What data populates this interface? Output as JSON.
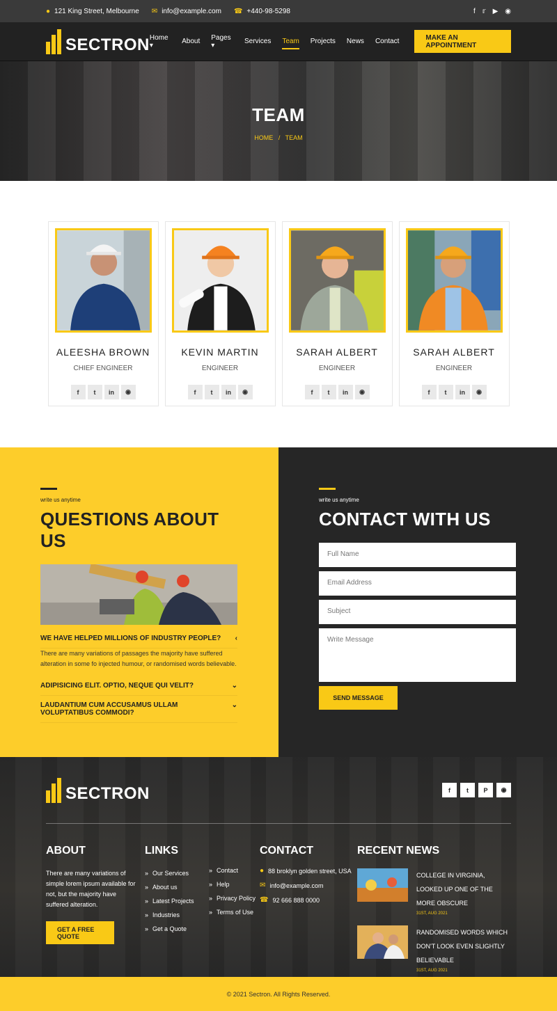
{
  "topbar": {
    "address": "121 King Street, Melbourne",
    "email": "info@example.com",
    "phone": "+440-98-5298",
    "social_icons": [
      "facebook-icon",
      "twitter-icon",
      "youtube-icon",
      "instagram-icon"
    ]
  },
  "brand": {
    "name": "SECTRON"
  },
  "nav": {
    "items": [
      {
        "label": "Home",
        "dropdown": true
      },
      {
        "label": "About",
        "dropdown": false
      },
      {
        "label": "Pages",
        "dropdown": true
      },
      {
        "label": "Services",
        "dropdown": false
      },
      {
        "label": "Team",
        "dropdown": false,
        "active": true
      },
      {
        "label": "Projects",
        "dropdown": false
      },
      {
        "label": "News",
        "dropdown": false
      },
      {
        "label": "Contact",
        "dropdown": false
      }
    ],
    "cta": "MAKE AN APPOINTMENT"
  },
  "hero": {
    "title": "TEAM",
    "crumb_home": "HOME",
    "crumb_sep": "/",
    "crumb_current": "TEAM"
  },
  "team": [
    {
      "name": "ALEESHA BROWN",
      "role": "CHIEF ENGINEER"
    },
    {
      "name": "KEVIN MARTIN",
      "role": "ENGINEER"
    },
    {
      "name": "SARAH ALBERT",
      "role": "ENGINEER"
    },
    {
      "name": "SARAH ALBERT",
      "role": "ENGINEER"
    }
  ],
  "questions": {
    "kicker": "write us anytime",
    "title": "QUESTIONS ABOUT US",
    "faqs": [
      {
        "q": "WE HAVE HELPED MILLIONS OF INDUSTRY PEOPLE?",
        "a": "There are many variations of passages the majority have suffered alteration in some fo injected humour, or randomised words believable.",
        "open": true
      },
      {
        "q": "ADIPISICING ELIT. OPTIO, NEQUE QUI VELIT?",
        "a": "",
        "open": false
      },
      {
        "q": "LAUDANTIUM CUM ACCUSAMUS ULLAM VOLUPTATIBUS COMMODI?",
        "a": "",
        "open": false
      }
    ]
  },
  "contact": {
    "kicker": "write us anytime",
    "title": "CONTACT WITH US",
    "full_name_ph": "Full Name",
    "email_ph": "Email Address",
    "subject_ph": "Subject",
    "message_ph": "Write Message",
    "send": "SEND MESSAGE"
  },
  "footer": {
    "social_icons": [
      "facebook-icon",
      "twitter-icon",
      "pinterest-icon",
      "instagram-icon"
    ],
    "about_title": "ABOUT",
    "about_text": "There are many variations of simple lorem ipsum available for not, but the majority have suffered alteration.",
    "quote_button": "GET A FREE QUOTE",
    "links_title": "LINKS",
    "links_col1": [
      "Our Services",
      "About us",
      "Latest Projects",
      "Industries",
      "Get a Quote"
    ],
    "links_col2": [
      "Contact",
      "Help",
      "Privacy Policy",
      "Terms of Use"
    ],
    "contact_title": "CONTACT",
    "contact_address": "88 broklyn golden street, USA",
    "contact_email": "info@example.com",
    "contact_phone": "92 666 888 0000",
    "news_title": "RECENT NEWS",
    "news": [
      {
        "title": "COLLEGE IN VIRGINIA, LOOKED UP ONE OF THE MORE OBSCURE",
        "date": "31ST, AUG 2021"
      },
      {
        "title": "RANDOMISED WORDS WHICH DON'T LOOK EVEN SLIGHTLY BELIEVABLE",
        "date": "31ST, AUG 2021"
      }
    ],
    "copyright": "© 2021 Sectron. All Rights Reserved."
  },
  "colors": {
    "accent": "#f9c916",
    "dark": "#222222",
    "panel": "#262626"
  }
}
